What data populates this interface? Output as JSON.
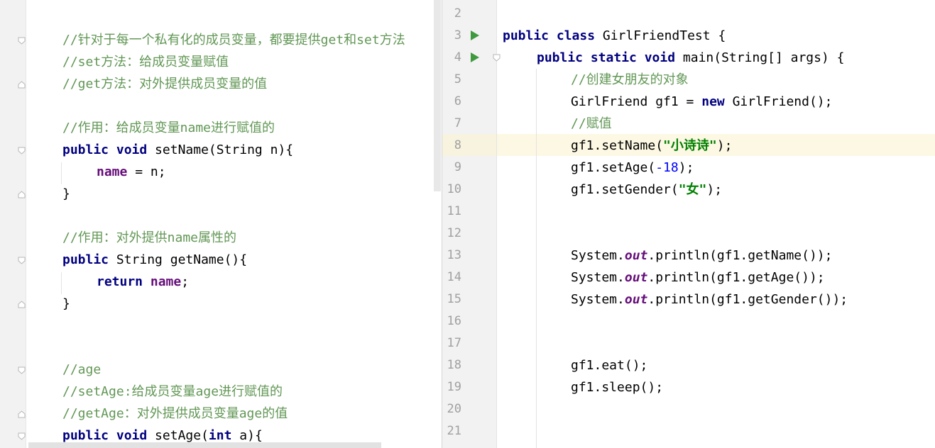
{
  "left_editor": {
    "lines": [
      {
        "kind": "comment",
        "text": "//针对于每一个私有化的成员变量，都要提供get和set方法"
      },
      {
        "kind": "comment",
        "text": "//set方法：给成员变量赋值"
      },
      {
        "kind": "comment",
        "text": "//get方法：对外提供成员变量的值"
      },
      {
        "kind": "blank",
        "text": ""
      },
      {
        "kind": "comment",
        "text": "//作用：给成员变量name进行赋值的"
      },
      {
        "kind": "code",
        "kw": "public void",
        "rest": " setName(String n){"
      },
      {
        "kind": "code",
        "field": "name",
        "rest": " = n;"
      },
      {
        "kind": "code",
        "rest": "}"
      },
      {
        "kind": "blank",
        "text": ""
      },
      {
        "kind": "comment",
        "text": "//作用：对外提供name属性的"
      },
      {
        "kind": "code",
        "kw": "public",
        "rest": " String getName(){"
      },
      {
        "kind": "code",
        "kw": "return",
        "field": "name",
        "rest": ";"
      },
      {
        "kind": "code",
        "rest": "}"
      },
      {
        "kind": "blank",
        "text": ""
      },
      {
        "kind": "blank",
        "text": ""
      },
      {
        "kind": "comment",
        "text": "//age"
      },
      {
        "kind": "comment",
        "text": "//setAge:给成员变量age进行赋值的"
      },
      {
        "kind": "comment",
        "text": "//getAge：对外提供成员变量age的值"
      },
      {
        "kind": "code",
        "kw": "public void",
        "rest": " setAge(",
        "kw2": "int",
        "rest2": " a){"
      }
    ]
  },
  "right_editor": {
    "line_numbers": [
      "2",
      "3",
      "4",
      "5",
      "6",
      "7",
      "8",
      "9",
      "10",
      "11",
      "12",
      "13",
      "14",
      "15",
      "16",
      "17",
      "18",
      "19",
      "20",
      "21"
    ],
    "caret_line": "8",
    "code": {
      "l3_kw": "public class",
      "l3_rest": " GirlFriendTest {",
      "l4_kw": "public static void",
      "l4_rest": " main(String[] args) {",
      "l5_comment": "//创建女朋友的对象",
      "l6_a": "GirlFriend gf1 = ",
      "l6_kw": "new",
      "l6_b": " GirlFriend();",
      "l7_comment": "//赋值",
      "l8_a": "gf1.setName(",
      "l8_str": "\"小诗诗\"",
      "l8_b": ");",
      "l9_a": "gf1.setAge(",
      "l9_num": "-18",
      "l9_b": ");",
      "l10_a": "gf1.setGender(",
      "l10_str": "\"女\"",
      "l10_b": ");",
      "l13_a": "System.",
      "l13_out": "out",
      "l13_b": ".println(gf1.getName());",
      "l14_a": "System.",
      "l14_out": "out",
      "l14_b": ".println(gf1.getAge());",
      "l15_a": "System.",
      "l15_out": "out",
      "l15_b": ".println(gf1.getGender());",
      "l18": "gf1.eat();",
      "l19": "gf1.sleep();"
    }
  },
  "icons": {
    "run": "run-triangle-icon",
    "fold": "fold-marker-icon"
  },
  "colors": {
    "keyword": "#000080",
    "comment": "#629755",
    "field": "#660e7a",
    "string": "#008000",
    "number": "#0000ff",
    "run_icon": "#3e9a3e",
    "caret_row": "#fcf8e3"
  }
}
